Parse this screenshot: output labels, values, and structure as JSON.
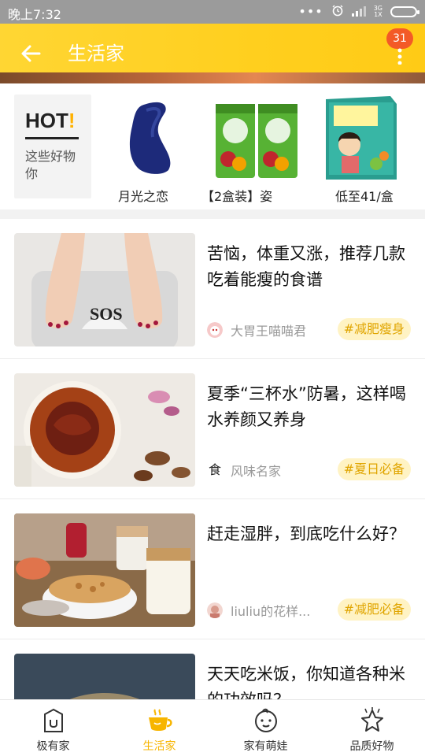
{
  "status_bar": {
    "time": "晚上7:32",
    "network_top": "3G",
    "network_bottom": "1X"
  },
  "header": {
    "title": "生活家",
    "notification_count": "31",
    "accent_color": "#ffcf1e"
  },
  "hot_section": {
    "title": "HOT",
    "title_mark": "!",
    "subtitle": "这些好物你",
    "items": [
      {
        "label": "月光之恋",
        "icon": "pillow-product-image"
      },
      {
        "label": "【2盒装】姿",
        "icon": "tea-box-product-image"
      },
      {
        "label": "低至41/盒",
        "icon": "enzyme-box-product-image"
      }
    ]
  },
  "articles": [
    {
      "title": "苦恼，体重又涨，推荐几款吃着能瘦的食谱",
      "author": "大胃王喵喵君",
      "tag": "#减肥瘦身",
      "thumb_text": "SOS"
    },
    {
      "title": "夏季“三杯水”防暑，这样喝水养颜又养身",
      "author": "风味名家",
      "author_icon_text": "食",
      "tag": "#夏日必备"
    },
    {
      "title": "赶走湿胖，到底吃什么好？",
      "author": "liuliu的花样...",
      "tag": "#减肥必备"
    },
    {
      "title": "天天吃米饭，你知道各种米的功效吗？"
    }
  ],
  "bottom_nav": [
    {
      "label": "极有家",
      "icon": "home-bag-icon",
      "active": false
    },
    {
      "label": "生活家",
      "icon": "coffee-cup-icon",
      "active": true
    },
    {
      "label": "家有萌娃",
      "icon": "baby-face-icon",
      "active": false
    },
    {
      "label": "品质好物",
      "icon": "star-icon",
      "active": false
    }
  ],
  "colors": {
    "tag_bg": "#fff3c4",
    "tag_text": "#e0a500",
    "active_nav": "#f7b500",
    "badge": "#f35a27"
  }
}
